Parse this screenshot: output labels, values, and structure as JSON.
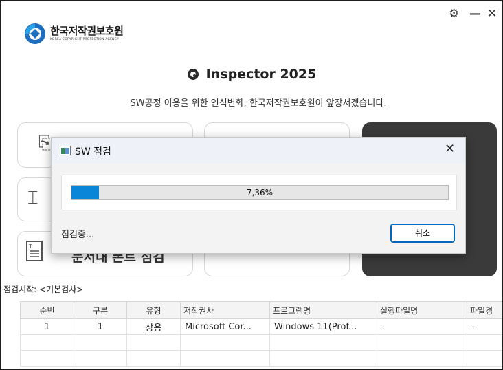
{
  "window": {
    "icons": {
      "settings": "gear-icon",
      "minimize": "minus-icon",
      "close": "close-icon"
    }
  },
  "logo": {
    "korean": "한국저작권보호원",
    "english": "KOREA COPYRIGHT PROTECTION AGENCY"
  },
  "header": {
    "title": "Inspector 2025",
    "subtitle": "SW공정 이용을 위한 인식변화, 한국저작권보호원이 앞장서겠습니다."
  },
  "cards": [
    {
      "icon": "document-icon",
      "label": "문서내 폰트 점검"
    }
  ],
  "scan": {
    "start_label": "점검시작: <기본검사>"
  },
  "table": {
    "columns": [
      "순번",
      "구분",
      "유형",
      "저작권사",
      "프로그램명",
      "실행파일명",
      "파일경"
    ],
    "rows": [
      [
        "1",
        "1",
        "상용",
        "Microsoft Cor...",
        "Windows 11(Prof...",
        "-",
        "-"
      ]
    ]
  },
  "dialog": {
    "title": "SW 점검",
    "progress_percent": 7.36,
    "progress_text": "7,36%",
    "status": "점검중...",
    "cancel_label": "취소"
  },
  "colors": {
    "accent": "#0a86d8",
    "logo_blue": "#1e6fc0",
    "dark_card": "#3a3a3a"
  }
}
